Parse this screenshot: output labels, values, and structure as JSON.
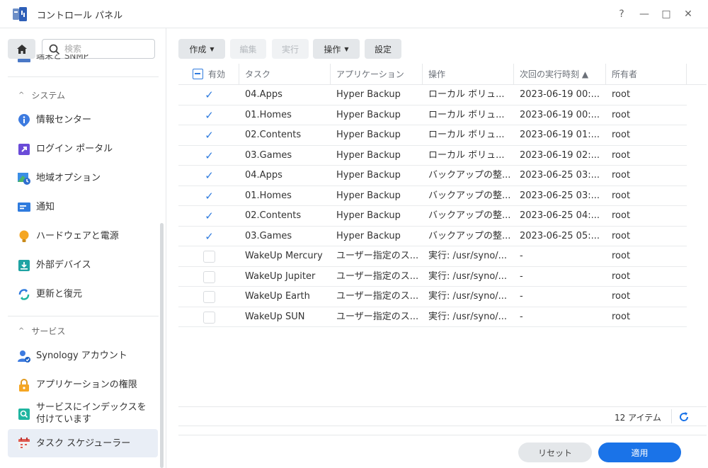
{
  "window": {
    "title": "コントロール パネル",
    "help_label": "?",
    "minimize_label": "—",
    "maximize_label": "□",
    "close_label": "✕"
  },
  "sidebar": {
    "search_placeholder": "検索",
    "cut_item_label": "端末と SNMP",
    "sections": [
      {
        "label": "システム",
        "chevron": "^"
      },
      {
        "label": "サービス",
        "chevron": "^"
      }
    ],
    "items": [
      {
        "label": "情報センター",
        "icon": "info-icon"
      },
      {
        "label": "ログイン ポータル",
        "icon": "login-portal-icon"
      },
      {
        "label": "地域オプション",
        "icon": "regional-options-icon"
      },
      {
        "label": "通知",
        "icon": "notification-icon"
      },
      {
        "label": "ハードウェアと電源",
        "icon": "hardware-power-icon"
      },
      {
        "label": "外部デバイス",
        "icon": "external-device-icon"
      },
      {
        "label": "更新と復元",
        "icon": "update-restore-icon"
      },
      {
        "label": "Synology アカウント",
        "icon": "synology-account-icon"
      },
      {
        "label": "アプリケーションの権限",
        "icon": "app-privileges-icon"
      },
      {
        "label": "サービスにインデックスを\n付けています",
        "icon": "indexing-service-icon"
      },
      {
        "label": "タスク スケジューラー",
        "icon": "task-scheduler-icon"
      }
    ]
  },
  "toolbar": {
    "create": "作成",
    "edit": "編集",
    "run": "実行",
    "action": "操作",
    "settings": "設定"
  },
  "table": {
    "headers": {
      "enabled": "有効",
      "task": "タスク",
      "application": "アプリケーション",
      "action": "操作",
      "next_run": "次回の実行時刻 ▲",
      "owner": "所有者"
    },
    "rows": [
      {
        "enabled": true,
        "task": "04.Apps",
        "app": "Hyper Backup",
        "action": "ローカル ボリュ...",
        "next": "2023-06-19 00:...",
        "owner": "root"
      },
      {
        "enabled": true,
        "task": "01.Homes",
        "app": "Hyper Backup",
        "action": "ローカル ボリュ...",
        "next": "2023-06-19 00:...",
        "owner": "root"
      },
      {
        "enabled": true,
        "task": "02.Contents",
        "app": "Hyper Backup",
        "action": "ローカル ボリュ...",
        "next": "2023-06-19 01:...",
        "owner": "root"
      },
      {
        "enabled": true,
        "task": "03.Games",
        "app": "Hyper Backup",
        "action": "ローカル ボリュ...",
        "next": "2023-06-19 02:...",
        "owner": "root"
      },
      {
        "enabled": true,
        "task": "04.Apps",
        "app": "Hyper Backup",
        "action": "バックアップの整...",
        "next": "2023-06-25 03:...",
        "owner": "root"
      },
      {
        "enabled": true,
        "task": "01.Homes",
        "app": "Hyper Backup",
        "action": "バックアップの整...",
        "next": "2023-06-25 03:...",
        "owner": "root"
      },
      {
        "enabled": true,
        "task": "02.Contents",
        "app": "Hyper Backup",
        "action": "バックアップの整...",
        "next": "2023-06-25 04:...",
        "owner": "root"
      },
      {
        "enabled": true,
        "task": "03.Games",
        "app": "Hyper Backup",
        "action": "バックアップの整...",
        "next": "2023-06-25 05:...",
        "owner": "root"
      },
      {
        "enabled": false,
        "task": "WakeUp Mercury",
        "app": "ユーザー指定のス...",
        "action": "実行: /usr/syno/...",
        "next": "-",
        "owner": "root"
      },
      {
        "enabled": false,
        "task": "WakeUp Jupiter",
        "app": "ユーザー指定のス...",
        "action": "実行: /usr/syno/...",
        "next": "-",
        "owner": "root"
      },
      {
        "enabled": false,
        "task": "WakeUp Earth",
        "app": "ユーザー指定のス...",
        "action": "実行: /usr/syno/...",
        "next": "-",
        "owner": "root"
      },
      {
        "enabled": false,
        "task": "WakeUp SUN",
        "app": "ユーザー指定のス...",
        "action": "実行: /usr/syno/...",
        "next": "-",
        "owner": "root"
      }
    ]
  },
  "footer": {
    "count": "12 アイテム",
    "reset": "リセット",
    "apply": "適用"
  },
  "colors": {
    "accent": "#1a73e8",
    "checkbox": "#2f7bde",
    "active_nav": "#e9eef6"
  }
}
